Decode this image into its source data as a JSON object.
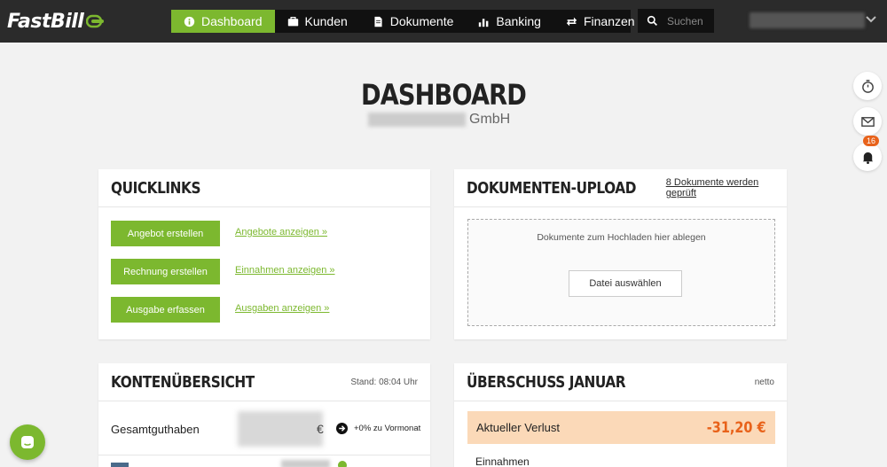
{
  "app": {
    "logo_text": "FastBill"
  },
  "nav": {
    "items": [
      {
        "label": "Dashboard",
        "icon": "info-icon",
        "active": true
      },
      {
        "label": "Kunden",
        "icon": "briefcase-icon"
      },
      {
        "label": "Dokumente",
        "icon": "document-icon"
      },
      {
        "label": "Banking",
        "icon": "bar-chart-icon"
      },
      {
        "label": "Finanzen",
        "icon": "exchange-icon"
      }
    ]
  },
  "search": {
    "placeholder": "Suchen"
  },
  "header": {
    "title": "DASHBOARD",
    "company_suffix": "GmbH"
  },
  "side_tools": {
    "notifications_count": "16"
  },
  "quicklinks": {
    "title": "QUICKLINKS",
    "rows": [
      {
        "button": "Angebot erstellen",
        "link": "Angebote anzeigen »"
      },
      {
        "button": "Rechnung erstellen",
        "link": "Einnahmen anzeigen »"
      },
      {
        "button": "Ausgabe erfassen",
        "link": "Ausgaben anzeigen »"
      }
    ]
  },
  "upload": {
    "title": "DOKUMENTEN-UPLOAD",
    "status_link": "8 Dokumente werden geprüft",
    "drop_text": "Dokumente zum Hochladen hier ablegen",
    "button": "Datei auswählen"
  },
  "accounts": {
    "title": "KONTENÜBERSICHT",
    "stand": "Stand: 08:04 Uhr",
    "total_label": "Gesamtguthaben",
    "currency": "€",
    "change": "+0% zu Vormonat"
  },
  "surplus": {
    "title": "ÜBERSCHUSS JANUAR",
    "meta": "netto",
    "loss_label": "Aktueller Verlust",
    "loss_value": "-31,20 €",
    "income_label": "Einnahmen"
  },
  "colors": {
    "accent": "#7cb82f",
    "topbar": "#2b2b2b",
    "loss_bg": "#fbd9b8",
    "loss_text": "#e8621a"
  }
}
